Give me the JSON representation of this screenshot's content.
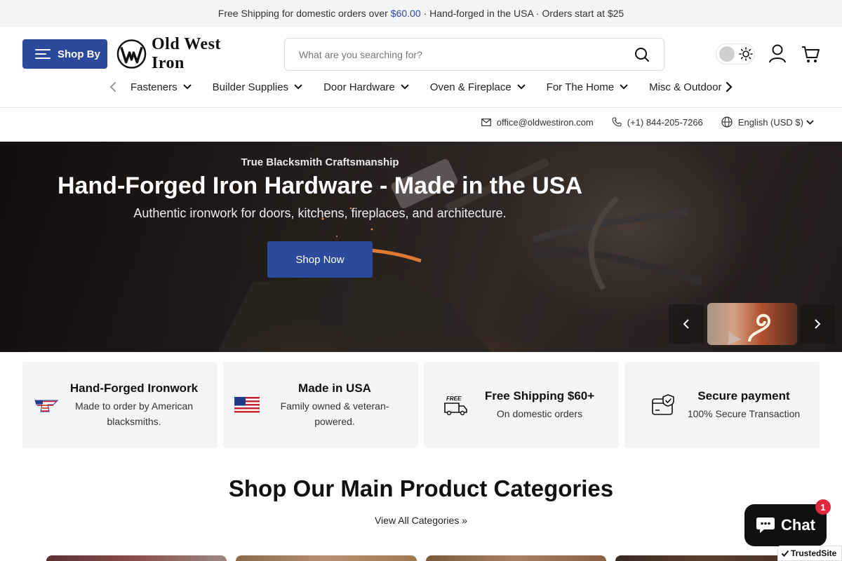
{
  "announcement": {
    "prefix": "Free Shipping for domestic orders over",
    "amount": "$60.00",
    "suffix": "· Hand-forged in the USA · Orders start at $25"
  },
  "header": {
    "shop_by_label": "Shop By",
    "logo_text": "Old West Iron",
    "search_placeholder": "What are you searching for?"
  },
  "nav": {
    "items": [
      {
        "label": "Fasteners"
      },
      {
        "label": "Builder Supplies"
      },
      {
        "label": "Door Hardware"
      },
      {
        "label": "Oven & Fireplace"
      },
      {
        "label": "For The Home"
      },
      {
        "label": "Misc & Outdoor"
      }
    ]
  },
  "contact": {
    "email": "office@oldwestiron.com",
    "phone": "(+1) 844-205-7266",
    "locale": "English (USD $)"
  },
  "hero": {
    "eyebrow": "True Blacksmith Craftsmanship",
    "title": "Hand-Forged Iron Hardware - Made in the USA",
    "subtitle": "Authentic ironwork for doors, kitchens, fireplaces, and architecture.",
    "cta": "Shop Now"
  },
  "features": [
    {
      "title": "Hand-Forged Ironwork",
      "desc": "Made to order by American blacksmiths.",
      "icon": "flag-anvil-icon"
    },
    {
      "title": "Made in USA",
      "desc": "Family owned & veteran-powered.",
      "icon": "us-flag-icon"
    },
    {
      "title": "Free Shipping $60+",
      "desc": "On domestic orders",
      "icon": "free-shipping-truck-icon"
    },
    {
      "title": "Secure payment",
      "desc": "100% Secure Transaction",
      "icon": "secure-card-icon"
    }
  ],
  "categories_section": {
    "title": "Shop Our Main Product Categories",
    "view_all": "View All Categories »"
  },
  "chat": {
    "label": "Chat",
    "badge": "1"
  },
  "trusted_site": {
    "prefix": "TrustedSite"
  },
  "colors": {
    "brand": "#2b4a9c",
    "chat_bg": "#101010",
    "badge": "#e0283f"
  }
}
